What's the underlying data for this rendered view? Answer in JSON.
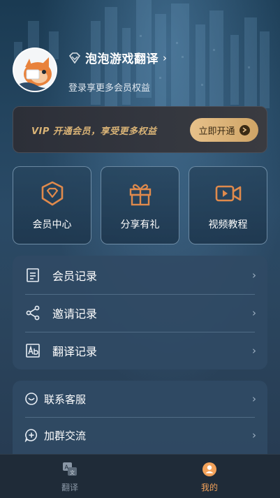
{
  "profile": {
    "name": "泡泡游戏翻译",
    "subtitle": "登录享更多会员权益"
  },
  "vip_banner": {
    "text": "VIP 开通会员，享受更多权益",
    "button_label": "立即开通"
  },
  "features": [
    {
      "label": "会员中心",
      "icon": "diamond-badge-icon"
    },
    {
      "label": "分享有礼",
      "icon": "gift-icon"
    },
    {
      "label": "视频教程",
      "icon": "video-icon"
    }
  ],
  "records": [
    {
      "label": "会员记录",
      "icon": "document-list-icon"
    },
    {
      "label": "邀请记录",
      "icon": "share-icon"
    },
    {
      "label": "翻译记录",
      "icon": "translate-icon"
    }
  ],
  "support": [
    {
      "label": "联系客服",
      "icon": "customer-service-icon"
    },
    {
      "label": "加群交流",
      "icon": "group-chat-icon"
    }
  ],
  "tabbar": {
    "tabs": [
      {
        "label": "翻译",
        "icon": "translate-tab-icon",
        "active": false
      },
      {
        "label": "我的",
        "icon": "profile-tab-icon",
        "active": true
      }
    ]
  },
  "colors": {
    "accent_gold": "#d9b376",
    "icon_orange": "#e08a4c",
    "active_tab": "#f3a25a",
    "inactive_tab": "#8a97a6"
  }
}
